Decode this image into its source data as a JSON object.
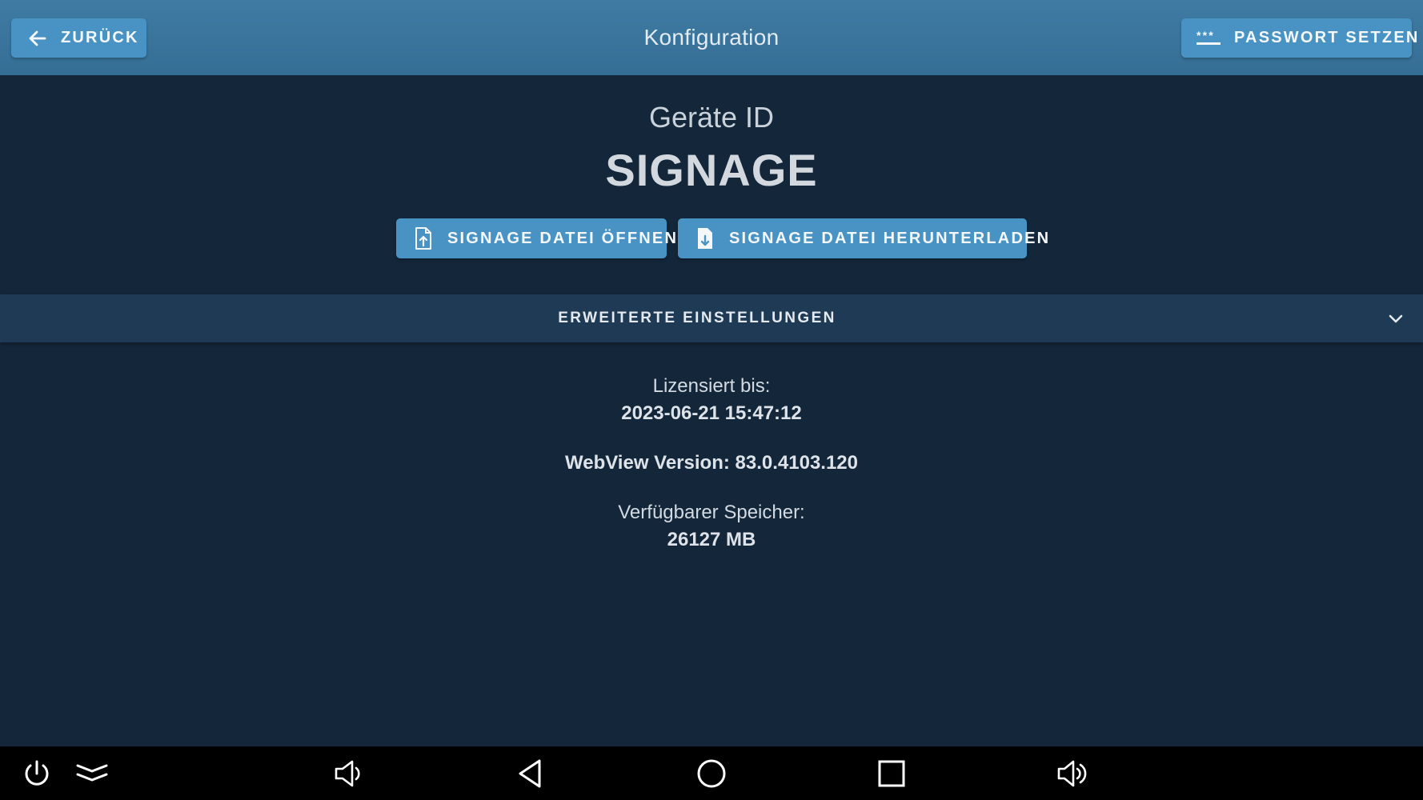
{
  "header": {
    "title": "Konfiguration",
    "back_label": "ZURÜCK",
    "back_icon": "arrow-left-icon",
    "password_label": "PASSWORT SETZEN",
    "password_icon": "password-icon"
  },
  "device": {
    "label": "Geräte ID",
    "id": "SIGNAGE"
  },
  "actions": {
    "open_label": "SIGNAGE DATEI ÖFFNEN",
    "open_icon": "file-upload-icon",
    "download_label": "SIGNAGE DATEI HERUNTERLADEN",
    "download_icon": "file-download-icon"
  },
  "advanced": {
    "label": "ERWEITERTE EINSTELLUNGEN",
    "icon": "chevron-down-icon"
  },
  "info": {
    "license_label": "Lizensiert bis:",
    "license_value": "2023-06-21 15:47:12",
    "webview": "WebView Version: 83.0.4103.120",
    "storage_label": "Verfügbarer Speicher:",
    "storage_value": "26127 MB"
  },
  "navbar": {
    "icons": [
      "power-icon",
      "notification-shade-icon",
      "volume-down-icon",
      "back-triangle-icon",
      "home-circle-icon",
      "recents-square-icon",
      "volume-up-icon"
    ]
  },
  "colors": {
    "header_bg": "#3a75a0",
    "button_bg": "#4993c4",
    "page_bg": "#13263a",
    "advanced_bg": "#1f3a55",
    "navbar_bg": "#000000"
  }
}
